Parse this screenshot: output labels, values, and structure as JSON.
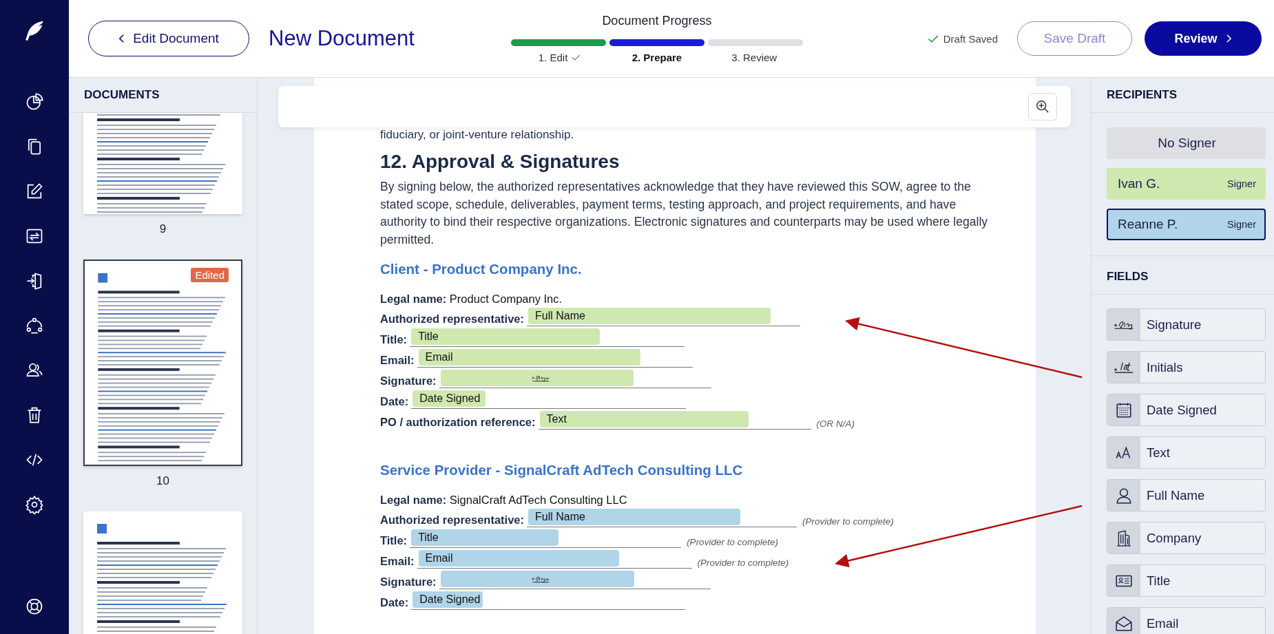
{
  "header": {
    "back_button": "Edit Document",
    "title": "New Document",
    "progress": {
      "label": "Document Progress",
      "steps": [
        {
          "label": "1. Edit",
          "done": true,
          "selected": false
        },
        {
          "label": "2. Prepare",
          "done": false,
          "selected": true
        },
        {
          "label": "3. Review",
          "done": false,
          "selected": false
        }
      ]
    },
    "save_status": "Draft Saved",
    "buttons": [
      {
        "label": "Save Draft",
        "kind": "secondary"
      },
      {
        "label": "Review",
        "kind": "primary"
      }
    ]
  },
  "documents": {
    "title": "DOCUMENTS",
    "pages": [
      {
        "label": "9",
        "selected": false
      },
      {
        "label": "10",
        "selected": true,
        "badge": "Edited"
      },
      {
        "selected": false
      }
    ]
  },
  "document": {
    "lead_line": "fiduciary, or joint-venture relationship.",
    "heading": "12. Approval & Signatures",
    "paragraph": "By signing below, the authorized representatives acknowledge that they have reviewed this SOW, agree to the stated scope, schedule, deliverables, payment terms, testing approach, and project requirements, and have authority to bind their respective organizations. Electronic signatures and counterparts may be used where legally permitted.",
    "sections": [
      {
        "title": "Client - Product Company Inc.",
        "color": "#cfe8b0",
        "rows": [
          {
            "kind": "value",
            "text": "**Legal name:** Product Company Inc."
          },
          {
            "kind": "field",
            "label": "Authorized representative:",
            "field": {
              "kind": "text",
              "text": "Full Name"
            }
          },
          {
            "kind": "field",
            "label": "Title:",
            "field": {
              "kind": "text",
              "text": "Title"
            }
          },
          {
            "kind": "field",
            "label": "Email:",
            "field": {
              "kind": "text",
              "text": "Email"
            }
          },
          {
            "kind": "field",
            "label": "Signature:",
            "field": {
              "kind": "signature"
            }
          },
          {
            "kind": "field",
            "label": "Date:",
            "field": {
              "kind": "text",
              "text": "Date Signed"
            }
          },
          {
            "kind": "field",
            "label": "PO / authorization reference:",
            "field": {
              "kind": "text",
              "text": "Text"
            },
            "note": "(OR N/A)"
          }
        ]
      },
      {
        "title": "Service Provider - SignalCraft AdTech Consulting LLC",
        "color": "#b0d4e8",
        "rows": [
          {
            "kind": "value",
            "text": "**Legal name:** SignalCraft AdTech Consulting LLC"
          },
          {
            "kind": "field",
            "label": "Authorized representative:",
            "field": {
              "kind": "text",
              "text": "Full Name"
            },
            "note": "(Provider to complete)"
          },
          {
            "kind": "field",
            "label": "Title:",
            "field": {
              "kind": "text",
              "text": "Title"
            },
            "note": "(Provider to complete)"
          },
          {
            "kind": "field",
            "label": "Email:",
            "field": {
              "kind": "text",
              "text": "Email"
            },
            "note": "(Provider to complete)"
          },
          {
            "kind": "field",
            "label": "Signature:",
            "field": {
              "kind": "signature"
            }
          },
          {
            "kind": "field",
            "label": "Date:",
            "field": {
              "kind": "text",
              "text": "Date Signed"
            }
          }
        ]
      }
    ]
  },
  "recipients": {
    "title": "RECIPIENTS",
    "items": [
      {
        "name": "No Signer",
        "color": "#dedfe2",
        "selected": false
      },
      {
        "name": "Ivan G.",
        "role": "Signer",
        "color": "#cfe8b0",
        "selected": false
      },
      {
        "name": "Reanne P.",
        "role": "Signer",
        "color": "#b0d4e8",
        "selected": true
      }
    ]
  },
  "fields": {
    "title": "FIELDS",
    "items": [
      {
        "kind": "signature",
        "label": "Signature"
      },
      {
        "kind": "initials",
        "label": "Initials"
      },
      {
        "kind": "date",
        "label": "Date Signed"
      },
      {
        "kind": "text",
        "label": "Text"
      },
      {
        "kind": "person",
        "label": "Full Name"
      },
      {
        "kind": "company",
        "label": "Company"
      },
      {
        "kind": "title",
        "label": "Title"
      },
      {
        "kind": "email",
        "label": "Email"
      }
    ]
  }
}
